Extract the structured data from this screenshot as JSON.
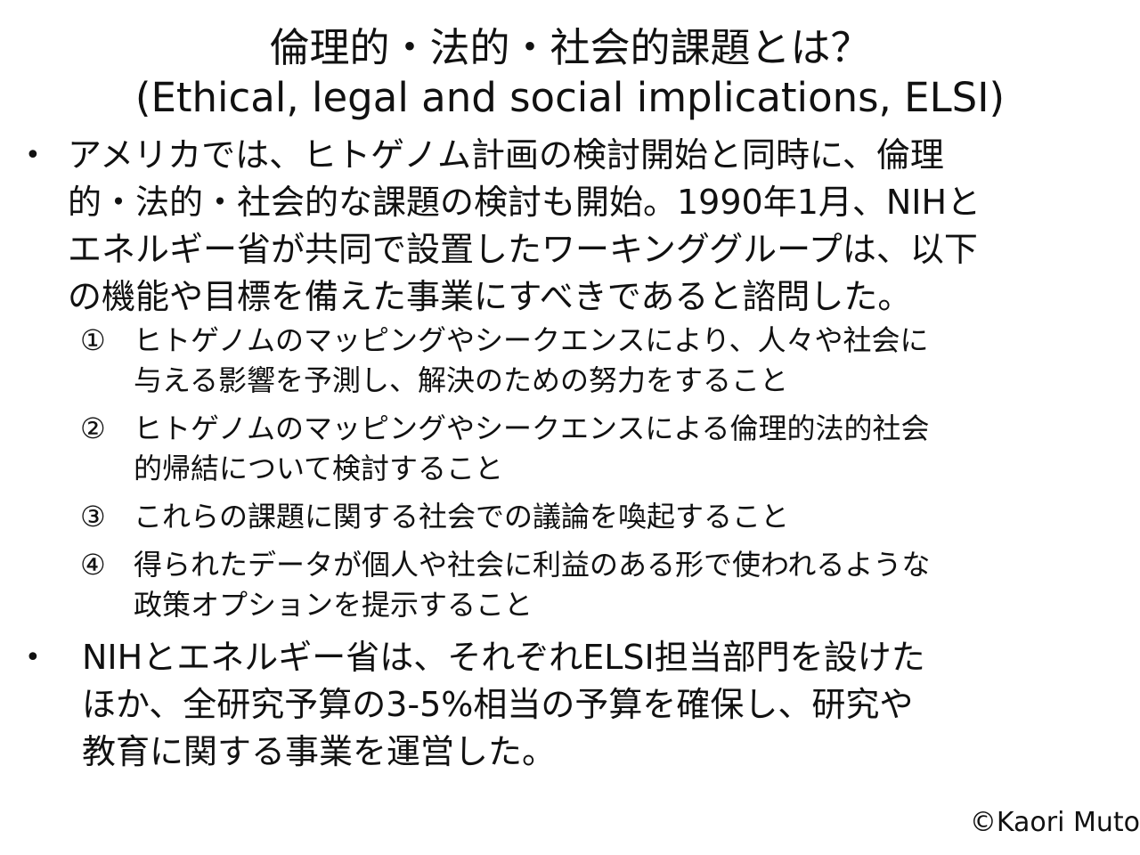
{
  "title": {
    "line1": "倫理的・法的・社会的課題とは？",
    "line2": "(Ethical, legal and social implications, ELSI)"
  },
  "bullet_symbol": "•",
  "bullets": [
    {
      "lines": [
        "アメリカでは、ヒトゲノム計画の検討開始と同時に、倫理",
        "的・法的・社会的な課題の検討も開始。1990年1月、NIHと",
        "エネルギー省が共同で設置したワーキンググループは、以下",
        "の機能や目標を備えた事業にすべきであると諮問した。"
      ]
    },
    {
      "lines": [
        "NIHとエネルギー省は、それぞれELSI担当部門を設けた",
        "ほか、全研究予算の3-5%相当の予算を確保し、研究や",
        "教育に関する事業を運営した。"
      ]
    }
  ],
  "subitems": [
    {
      "num": "①",
      "lines": [
        "ヒトゲノムのマッピングやシークエンスにより、人々や社会に",
        "与える影響を予測し、解決のための努力をすること"
      ]
    },
    {
      "num": "②",
      "lines": [
        "ヒトゲノムのマッピングやシークエンスによる倫理的法的社会",
        "的帰結について検討すること"
      ]
    },
    {
      "num": "③",
      "lines": [
        "これらの課題に関する社会での議論を喚起すること"
      ]
    },
    {
      "num": "④",
      "lines": [
        "得られたデータが個人や社会に利益のある形で使われるような",
        "政策オプションを提示すること"
      ]
    }
  ],
  "copyright": "©Kaori Muto"
}
